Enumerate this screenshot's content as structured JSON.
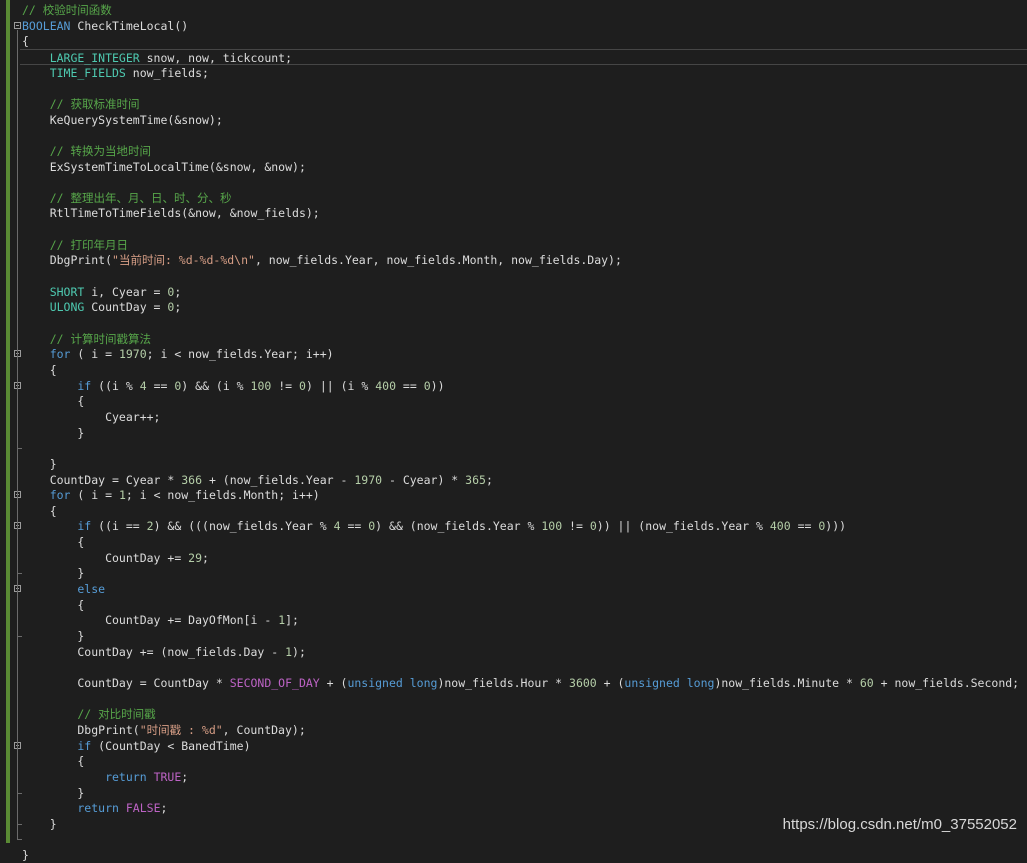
{
  "lines": [
    {
      "n": 0,
      "segments": [
        {
          "cls": "c",
          "text": "// 校验时间函数"
        }
      ]
    },
    {
      "n": 1,
      "segments": [
        {
          "cls": "k",
          "text": "BOOLEAN"
        },
        {
          "cls": "",
          "text": " CheckTimeLocal()"
        }
      ]
    },
    {
      "n": 2,
      "segments": [
        {
          "cls": "",
          "text": "{"
        }
      ]
    },
    {
      "n": 3,
      "segments": [
        {
          "cls": "t",
          "text": "    LARGE_INTEGER"
        },
        {
          "cls": "",
          "text": " snow, now, tickcount;"
        }
      ]
    },
    {
      "n": 4,
      "segments": [
        {
          "cls": "t",
          "text": "    TIME_FIELDS"
        },
        {
          "cls": "",
          "text": " now_fields;"
        }
      ]
    },
    {
      "n": 5,
      "segments": []
    },
    {
      "n": 6,
      "segments": [
        {
          "cls": "c",
          "text": "    // 获取标准时间"
        }
      ]
    },
    {
      "n": 7,
      "segments": [
        {
          "cls": "",
          "text": "    KeQuerySystemTime(&snow);"
        }
      ]
    },
    {
      "n": 8,
      "segments": []
    },
    {
      "n": 9,
      "segments": [
        {
          "cls": "c",
          "text": "    // 转换为当地时间"
        }
      ]
    },
    {
      "n": 10,
      "segments": [
        {
          "cls": "",
          "text": "    ExSystemTimeToLocalTime(&snow, &now);"
        }
      ]
    },
    {
      "n": 11,
      "segments": []
    },
    {
      "n": 12,
      "segments": [
        {
          "cls": "c",
          "text": "    // 整理出年、月、日、时、分、秒"
        }
      ]
    },
    {
      "n": 13,
      "segments": [
        {
          "cls": "",
          "text": "    RtlTimeToTimeFields(&now, &now_fields);"
        }
      ]
    },
    {
      "n": 14,
      "segments": []
    },
    {
      "n": 15,
      "segments": [
        {
          "cls": "c",
          "text": "    // 打印年月日"
        }
      ]
    },
    {
      "n": 16,
      "segments": [
        {
          "cls": "",
          "text": "    DbgPrint("
        },
        {
          "cls": "s",
          "text": "\"当前时间: %d-%d-%d\\n\""
        },
        {
          "cls": "",
          "text": ", now_fields.Year, now_fields.Month, now_fields.Day);"
        }
      ]
    },
    {
      "n": 17,
      "segments": []
    },
    {
      "n": 18,
      "segments": [
        {
          "cls": "t",
          "text": "    SHORT"
        },
        {
          "cls": "",
          "text": " i, Cyear = "
        },
        {
          "cls": "n",
          "text": "0"
        },
        {
          "cls": "",
          "text": ";"
        }
      ]
    },
    {
      "n": 19,
      "segments": [
        {
          "cls": "t",
          "text": "    ULONG"
        },
        {
          "cls": "",
          "text": " CountDay = "
        },
        {
          "cls": "n",
          "text": "0"
        },
        {
          "cls": "",
          "text": ";"
        }
      ]
    },
    {
      "n": 20,
      "segments": []
    },
    {
      "n": 21,
      "segments": [
        {
          "cls": "c",
          "text": "    // 计算时间戳算法"
        }
      ]
    },
    {
      "n": 22,
      "segments": [
        {
          "cls": "k",
          "text": "    for"
        },
        {
          "cls": "",
          "text": " ( i = "
        },
        {
          "cls": "n",
          "text": "1970"
        },
        {
          "cls": "",
          "text": "; i < now_fields.Year; i++)"
        }
      ]
    },
    {
      "n": 23,
      "segments": [
        {
          "cls": "",
          "text": "    {"
        }
      ]
    },
    {
      "n": 24,
      "segments": [
        {
          "cls": "k",
          "text": "        if"
        },
        {
          "cls": "",
          "text": " ((i % "
        },
        {
          "cls": "n",
          "text": "4"
        },
        {
          "cls": "",
          "text": " == "
        },
        {
          "cls": "n",
          "text": "0"
        },
        {
          "cls": "",
          "text": ") && (i % "
        },
        {
          "cls": "n",
          "text": "100"
        },
        {
          "cls": "",
          "text": " != "
        },
        {
          "cls": "n",
          "text": "0"
        },
        {
          "cls": "",
          "text": ") || (i % "
        },
        {
          "cls": "n",
          "text": "400"
        },
        {
          "cls": "",
          "text": " == "
        },
        {
          "cls": "n",
          "text": "0"
        },
        {
          "cls": "",
          "text": "))"
        }
      ]
    },
    {
      "n": 25,
      "segments": [
        {
          "cls": "",
          "text": "        {"
        }
      ]
    },
    {
      "n": 26,
      "segments": [
        {
          "cls": "",
          "text": "            Cyear++;"
        }
      ]
    },
    {
      "n": 27,
      "segments": [
        {
          "cls": "",
          "text": "        }"
        }
      ]
    },
    {
      "n": 28,
      "segments": []
    },
    {
      "n": 29,
      "segments": [
        {
          "cls": "",
          "text": "    }"
        }
      ]
    },
    {
      "n": 30,
      "segments": [
        {
          "cls": "",
          "text": "    CountDay = Cyear * "
        },
        {
          "cls": "n",
          "text": "366"
        },
        {
          "cls": "",
          "text": " + (now_fields.Year - "
        },
        {
          "cls": "n",
          "text": "1970"
        },
        {
          "cls": "",
          "text": " - Cyear) * "
        },
        {
          "cls": "n",
          "text": "365"
        },
        {
          "cls": "",
          "text": ";"
        }
      ]
    },
    {
      "n": 31,
      "segments": [
        {
          "cls": "k",
          "text": "    for"
        },
        {
          "cls": "",
          "text": " ( i = "
        },
        {
          "cls": "n",
          "text": "1"
        },
        {
          "cls": "",
          "text": "; i < now_fields.Month; i++)"
        }
      ]
    },
    {
      "n": 32,
      "segments": [
        {
          "cls": "",
          "text": "    {"
        }
      ]
    },
    {
      "n": 33,
      "segments": [
        {
          "cls": "k",
          "text": "        if"
        },
        {
          "cls": "",
          "text": " ((i == "
        },
        {
          "cls": "n",
          "text": "2"
        },
        {
          "cls": "",
          "text": ") && (((now_fields.Year % "
        },
        {
          "cls": "n",
          "text": "4"
        },
        {
          "cls": "",
          "text": " == "
        },
        {
          "cls": "n",
          "text": "0"
        },
        {
          "cls": "",
          "text": ") && (now_fields.Year % "
        },
        {
          "cls": "n",
          "text": "100"
        },
        {
          "cls": "",
          "text": " != "
        },
        {
          "cls": "n",
          "text": "0"
        },
        {
          "cls": "",
          "text": ")) || (now_fields.Year % "
        },
        {
          "cls": "n",
          "text": "400"
        },
        {
          "cls": "",
          "text": " == "
        },
        {
          "cls": "n",
          "text": "0"
        },
        {
          "cls": "",
          "text": ")))"
        }
      ]
    },
    {
      "n": 34,
      "segments": [
        {
          "cls": "",
          "text": "        {"
        }
      ]
    },
    {
      "n": 35,
      "segments": [
        {
          "cls": "",
          "text": "            CountDay += "
        },
        {
          "cls": "n",
          "text": "29"
        },
        {
          "cls": "",
          "text": ";"
        }
      ]
    },
    {
      "n": 36,
      "segments": [
        {
          "cls": "",
          "text": "        }"
        }
      ]
    },
    {
      "n": 37,
      "segments": [
        {
          "cls": "k",
          "text": "        else"
        }
      ]
    },
    {
      "n": 38,
      "segments": [
        {
          "cls": "",
          "text": "        {"
        }
      ]
    },
    {
      "n": 39,
      "segments": [
        {
          "cls": "",
          "text": "            CountDay += DayOfMon[i - "
        },
        {
          "cls": "n",
          "text": "1"
        },
        {
          "cls": "",
          "text": "];"
        }
      ]
    },
    {
      "n": 40,
      "segments": [
        {
          "cls": "",
          "text": "        }"
        }
      ]
    },
    {
      "n": 41,
      "segments": [
        {
          "cls": "",
          "text": "        CountDay += (now_fields.Day - "
        },
        {
          "cls": "n",
          "text": "1"
        },
        {
          "cls": "",
          "text": ");"
        }
      ]
    },
    {
      "n": 42,
      "segments": []
    },
    {
      "n": 43,
      "segments": [
        {
          "cls": "",
          "text": "        CountDay = CountDay * "
        },
        {
          "cls": "m",
          "text": "SECOND_OF_DAY"
        },
        {
          "cls": "",
          "text": " + ("
        },
        {
          "cls": "k",
          "text": "unsigned long"
        },
        {
          "cls": "",
          "text": ")now_fields.Hour * "
        },
        {
          "cls": "n",
          "text": "3600"
        },
        {
          "cls": "",
          "text": " + ("
        },
        {
          "cls": "k",
          "text": "unsigned long"
        },
        {
          "cls": "",
          "text": ")now_fields.Minute * "
        },
        {
          "cls": "n",
          "text": "60"
        },
        {
          "cls": "",
          "text": " + now_fields.Second;"
        }
      ]
    },
    {
      "n": 44,
      "segments": []
    },
    {
      "n": 45,
      "segments": [
        {
          "cls": "c",
          "text": "        // 对比时间戳"
        }
      ]
    },
    {
      "n": 46,
      "segments": [
        {
          "cls": "",
          "text": "        DbgPrint("
        },
        {
          "cls": "s",
          "text": "\"时间戳 : %d\""
        },
        {
          "cls": "",
          "text": ", CountDay);"
        }
      ]
    },
    {
      "n": 47,
      "segments": [
        {
          "cls": "k",
          "text": "        if"
        },
        {
          "cls": "",
          "text": " (CountDay < BanedTime)"
        }
      ]
    },
    {
      "n": 48,
      "segments": [
        {
          "cls": "",
          "text": "        {"
        }
      ]
    },
    {
      "n": 49,
      "segments": [
        {
          "cls": "k",
          "text": "            return"
        },
        {
          "cls": "",
          "text": " "
        },
        {
          "cls": "m",
          "text": "TRUE"
        },
        {
          "cls": "",
          "text": ";"
        }
      ]
    },
    {
      "n": 50,
      "segments": [
        {
          "cls": "",
          "text": "        }"
        }
      ]
    },
    {
      "n": 51,
      "segments": [
        {
          "cls": "k",
          "text": "        return"
        },
        {
          "cls": "",
          "text": " "
        },
        {
          "cls": "m",
          "text": "FALSE"
        },
        {
          "cls": "",
          "text": ";"
        }
      ]
    },
    {
      "n": 52,
      "segments": [
        {
          "cls": "",
          "text": "    }"
        }
      ]
    },
    {
      "n": 53,
      "segments": []
    },
    {
      "n": 54,
      "segments": [
        {
          "cls": "",
          "text": "}"
        }
      ]
    }
  ],
  "watermark": "https://blog.csdn.net/m0_37552052",
  "colors": {
    "comment": "#57a64a",
    "keyword": "#569cd6",
    "type": "#4ec9b0",
    "string": "#d69d85",
    "macro": "#bd63c5",
    "number": "#b5cea8",
    "background": "#1e1e1e"
  }
}
